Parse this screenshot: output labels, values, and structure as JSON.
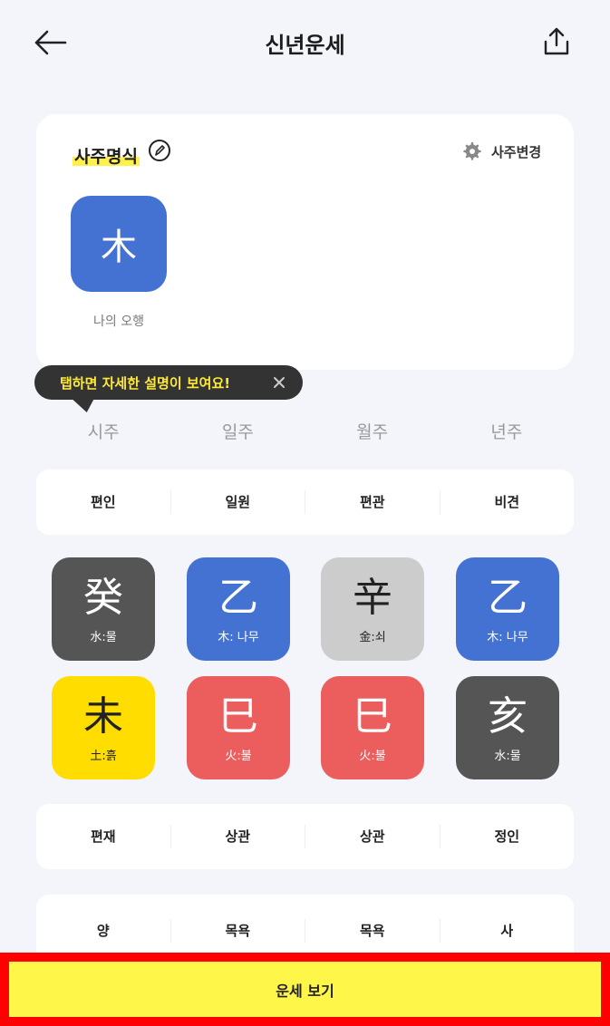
{
  "header": {
    "title": "신년운세",
    "back_icon": "arrow-left-icon",
    "share_icon": "share-icon"
  },
  "saju_card": {
    "title": "사주명식",
    "edit_icon": "pen-icon",
    "change_label": "사주변경",
    "my_element": "木",
    "my_element_caption": "나의 오행",
    "element_color": "#4472d3"
  },
  "tooltip": {
    "text": "탭하면 자세한 설명이 보여요!"
  },
  "pillars": [
    "시주",
    "일주",
    "월주",
    "년주"
  ],
  "ten_gods_top": [
    "편인",
    "일원",
    "편관",
    "비견"
  ],
  "stems": [
    {
      "char": "癸",
      "label": "水:물",
      "bg": "#555555",
      "fg": "#ffffff"
    },
    {
      "char": "乙",
      "label": "木: 나무",
      "bg": "#4472d3",
      "fg": "#ffffff"
    },
    {
      "char": "辛",
      "label": "金:쇠",
      "bg": "#cccccc",
      "fg": "#222222"
    },
    {
      "char": "乙",
      "label": "木: 나무",
      "bg": "#4472d3",
      "fg": "#ffffff"
    }
  ],
  "branches": [
    {
      "char": "未",
      "label": "土:흙",
      "bg": "#ffdd00",
      "fg": "#222222"
    },
    {
      "char": "巳",
      "label": "火:불",
      "bg": "#ec5e5e",
      "fg": "#ffffff"
    },
    {
      "char": "巳",
      "label": "火:불",
      "bg": "#ec5e5e",
      "fg": "#ffffff"
    },
    {
      "char": "亥",
      "label": "水:물",
      "bg": "#555555",
      "fg": "#ffffff"
    }
  ],
  "ten_gods_bottom": [
    "편재",
    "상관",
    "상관",
    "정인"
  ],
  "twelve_stages": [
    "양",
    "목욕",
    "목욕",
    "사"
  ],
  "cta": {
    "label": "운세 보기",
    "color": "#fff64a"
  }
}
